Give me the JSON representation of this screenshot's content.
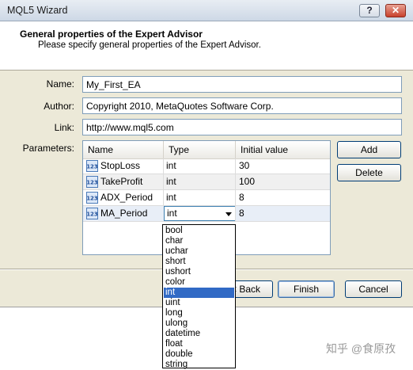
{
  "window": {
    "title": "MQL5 Wizard",
    "help_label": "?",
    "close_label": "✕"
  },
  "header": {
    "title": "General properties of the Expert Advisor",
    "subtitle": "Please specify general properties of the Expert Advisor."
  },
  "form": {
    "name_label": "Name:",
    "name_value": "My_First_EA",
    "author_label": "Author:",
    "author_value": "Copyright 2010, MetaQuotes Software Corp.",
    "link_label": "Link:",
    "link_value": "http://www.mql5.com",
    "parameters_label": "Parameters:"
  },
  "params_table": {
    "columns": [
      "Name",
      "Type",
      "Initial value"
    ],
    "rows": [
      {
        "name": "StopLoss",
        "type": "int",
        "value": "30"
      },
      {
        "name": "TakeProfit",
        "type": "int",
        "value": "100"
      },
      {
        "name": "ADX_Period",
        "type": "int",
        "value": "8"
      },
      {
        "name": "MA_Period",
        "type": "int",
        "value": "8"
      }
    ],
    "icon": "integer-param-icon"
  },
  "side_buttons": {
    "add": "Add",
    "delete": "Delete"
  },
  "nav_buttons": {
    "back": "< Back",
    "finish": "Finish",
    "cancel": "Cancel"
  },
  "type_dropdown": {
    "options": [
      "bool",
      "char",
      "uchar",
      "short",
      "ushort",
      "color",
      "int",
      "uint",
      "long",
      "ulong",
      "datetime",
      "float",
      "double",
      "string"
    ],
    "selected": "int"
  },
  "watermark": "知乎 @食原孜",
  "colors": {
    "selection": "#316ac5",
    "header_bg": "#ffffff",
    "dialog_bg": "#ece9d8"
  }
}
